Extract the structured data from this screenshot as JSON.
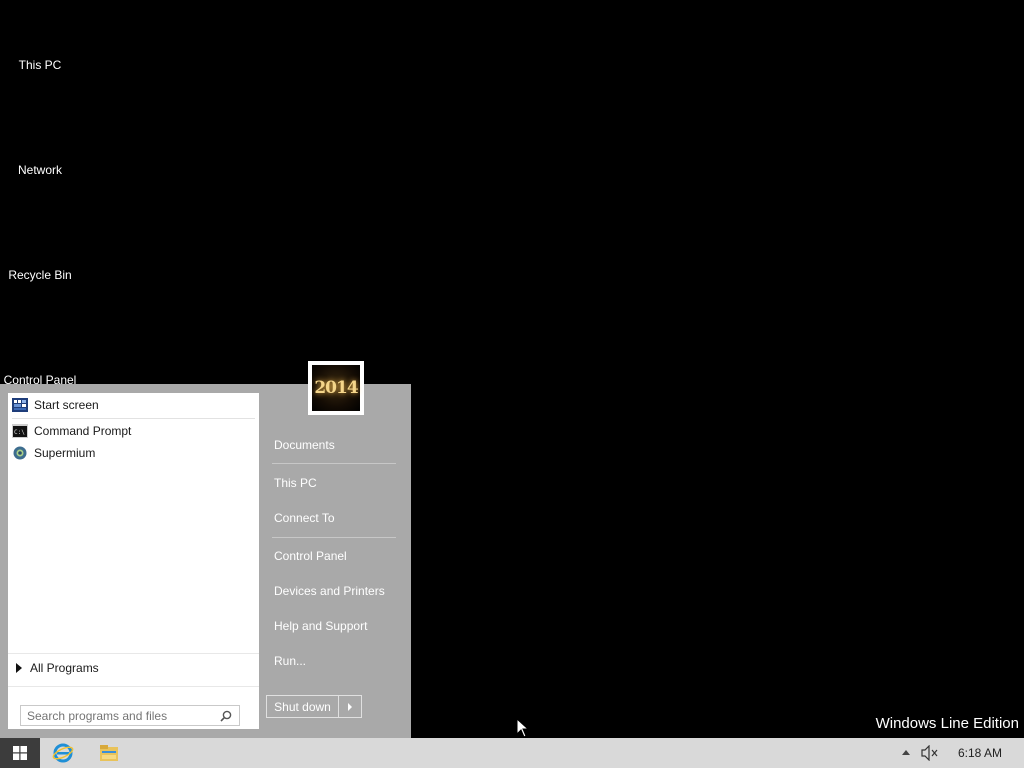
{
  "desktop": {
    "icons": [
      {
        "label": "This PC"
      },
      {
        "label": "Network"
      },
      {
        "label": "Recycle Bin"
      },
      {
        "label": "Control Panel"
      }
    ],
    "watermark": "Windows Line Edition"
  },
  "start_menu": {
    "user_picture_text": "2014",
    "programs": [
      {
        "label": "Start screen",
        "icon": "start-screen-icon"
      },
      {
        "label": "Command Prompt",
        "icon": "command-prompt-icon"
      },
      {
        "label": "Supermium",
        "icon": "supermium-icon"
      }
    ],
    "all_programs_label": "All Programs",
    "search_placeholder": "Search programs and files",
    "right_items": [
      {
        "label": "Documents"
      },
      {
        "label": "This PC"
      },
      {
        "label": "Connect To"
      },
      {
        "label": "Control Panel"
      },
      {
        "label": "Devices and Printers"
      },
      {
        "label": "Help and Support"
      },
      {
        "label": "Run..."
      }
    ],
    "shutdown_label": "Shut down"
  },
  "taskbar": {
    "apps": [
      {
        "name": "internet-explorer-icon"
      },
      {
        "name": "file-explorer-icon"
      }
    ],
    "clock": "6:18 AM",
    "volume_muted": true
  },
  "colors": {
    "menu_gray": "#a9a9a9",
    "taskbar": "#d9d9d9",
    "start_button": "#3c3c3c"
  }
}
